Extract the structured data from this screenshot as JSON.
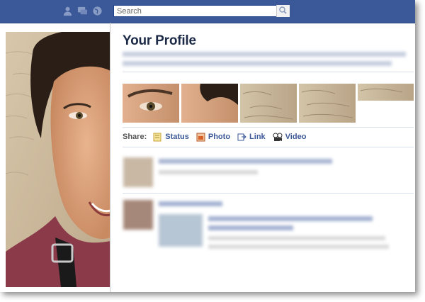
{
  "search": {
    "placeholder": "Search"
  },
  "profile": {
    "title": "Your Profile"
  },
  "share": {
    "label": "Share:",
    "items": [
      {
        "label": "Status",
        "icon": "status-icon"
      },
      {
        "label": "Photo",
        "icon": "photo-icon"
      },
      {
        "label": "Link",
        "icon": "link-icon"
      },
      {
        "label": "Video",
        "icon": "video-icon"
      }
    ]
  },
  "colors": {
    "brand_blue": "#3b5998",
    "link_blue": "#3b5998",
    "title": "#1c2a47"
  }
}
